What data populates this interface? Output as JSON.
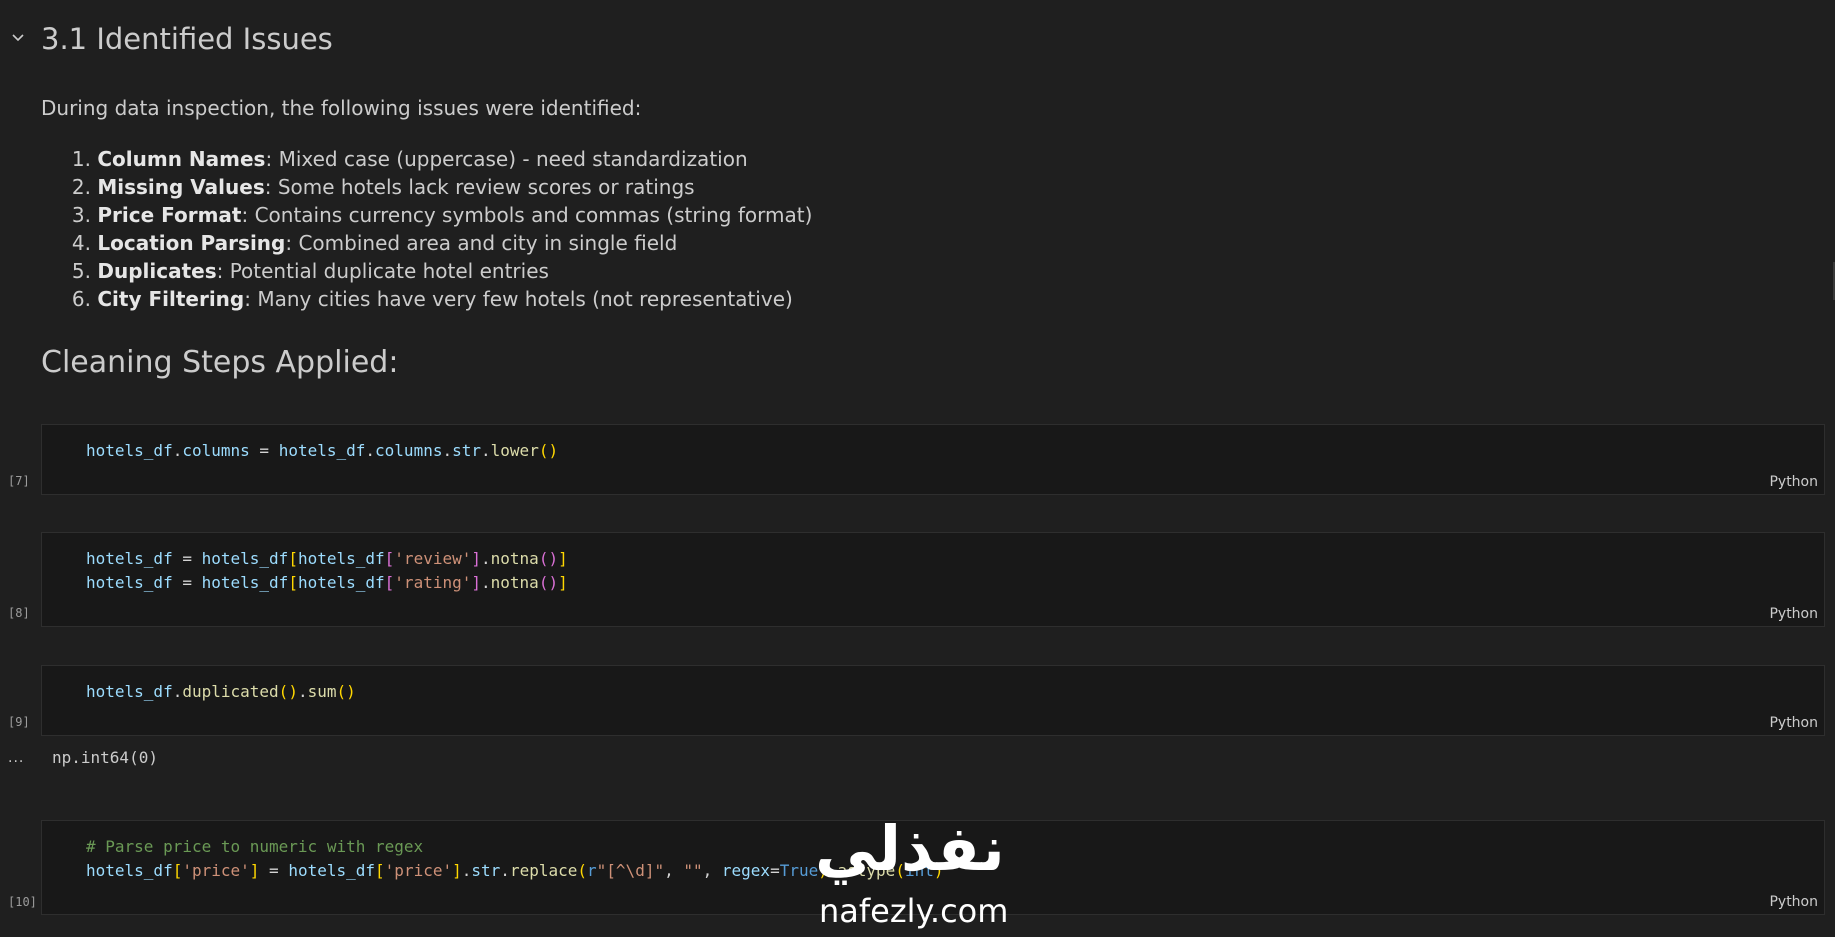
{
  "markdown": {
    "heading": "3.1 Identified Issues",
    "intro": "During data inspection, the following issues were identified:",
    "issues": [
      {
        "num": "1.",
        "title": "Column Names",
        "desc": ": Mixed case (uppercase) - need standardization"
      },
      {
        "num": "2.",
        "title": "Missing Values",
        "desc": ": Some hotels lack review scores or ratings"
      },
      {
        "num": "3.",
        "title": "Price Format",
        "desc": ": Contains currency symbols and commas (string format)"
      },
      {
        "num": "4.",
        "title": "Location Parsing",
        "desc": ": Combined area and city in single field"
      },
      {
        "num": "5.",
        "title": "Duplicates",
        "desc": ": Potential duplicate hotel entries"
      },
      {
        "num": "6.",
        "title": "City Filtering",
        "desc": ": Many cities have very few hotels (not representative)"
      }
    ],
    "subheading": "Cleaning Steps Applied:"
  },
  "cells": [
    {
      "exec": "[7]",
      "language": "Python",
      "tokens": {
        "a1": "hotels_df",
        "a2": ".",
        "a3": "columns",
        "a4": " = ",
        "a5": "hotels_df",
        "a6": ".",
        "a7": "columns",
        "a8": ".",
        "a9": "str",
        "a10": ".",
        "a11": "lower",
        "a12": "(",
        "a13": ")"
      }
    },
    {
      "exec": "[8]",
      "language": "Python",
      "tokens": {
        "l1": [
          "hotels_df",
          " = ",
          "hotels_df",
          "[",
          "hotels_df",
          "[",
          "'review'",
          "]",
          ".",
          "notna",
          "(",
          ")",
          "]"
        ],
        "l2": [
          "hotels_df",
          " = ",
          "hotels_df",
          "[",
          "hotels_df",
          "[",
          "'rating'",
          "]",
          ".",
          "notna",
          "(",
          ")",
          "]"
        ]
      }
    },
    {
      "exec": "[9]",
      "language": "Python",
      "tokens": [
        "hotels_df",
        ".",
        "duplicated",
        "(",
        ")",
        ".",
        "sum",
        "(",
        ")"
      ],
      "output_marker": "...",
      "output": "np.int64(0)"
    },
    {
      "exec": "[10]",
      "language": "Python",
      "comment": "# Parse price to numeric with regex",
      "tokens": [
        "hotels_df",
        "[",
        "'price'",
        "]",
        " = ",
        "hotels_df",
        "[",
        "'price'",
        "]",
        ".",
        "str",
        ".",
        "replace",
        "(",
        "r",
        "\"[^\\d]\"",
        ", ",
        "\"\"",
        ", ",
        "regex",
        "=",
        "True",
        ")",
        ".",
        "astype",
        "(",
        "int",
        ")"
      ]
    }
  ],
  "watermark": {
    "arabic": "نفذلي",
    "latin": "nafezly.com"
  },
  "colors": {
    "background": "#1f1f1f",
    "cell_background": "#181818",
    "variable": "#9cdcfe",
    "function": "#dcdcaa",
    "string": "#ce9178",
    "keyword": "#569cd6",
    "comment": "#6a9955"
  }
}
